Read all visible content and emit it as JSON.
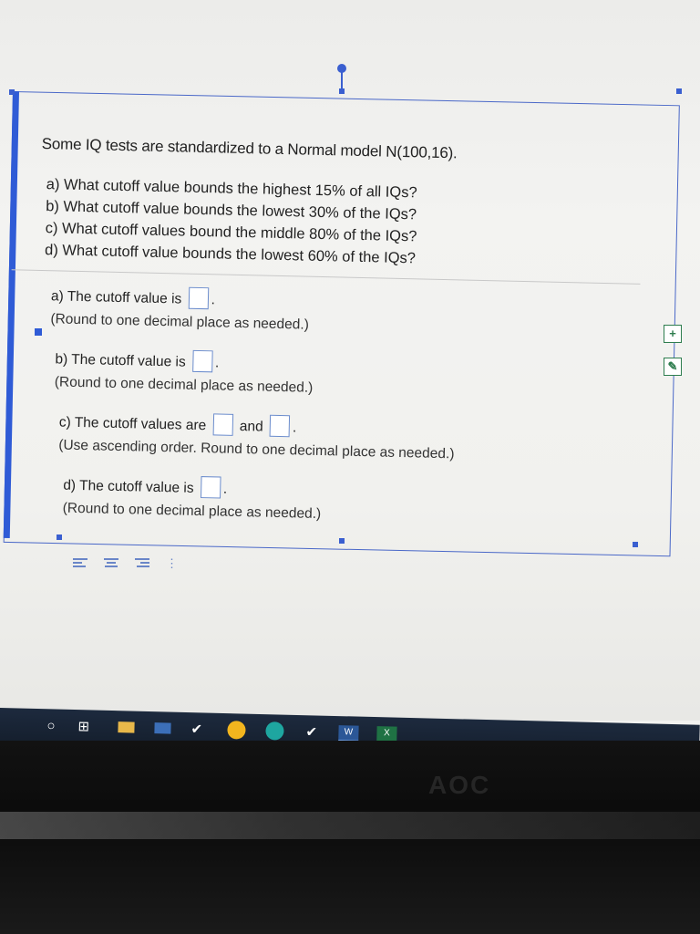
{
  "question": {
    "stem": "Some IQ tests are standardized to a Normal model N(100,16).",
    "parts": [
      "a) What cutoff value bounds the highest 15% of all IQs?",
      "b) What cutoff value bounds the lowest 30% of the IQs?",
      "c) What cutoff values bound the middle 80% of the IQs?",
      "d) What cutoff value bounds the lowest 60% of the IQs?"
    ]
  },
  "answers": {
    "a": {
      "label": "a) The cutoff value is",
      "suffix": ".",
      "value": "",
      "note": "(Round to one decimal place as needed.)"
    },
    "b": {
      "label": "b) The cutoff value is",
      "suffix": ".",
      "value": "",
      "note": "(Round to one decimal place as needed.)"
    },
    "c": {
      "label": "c) The cutoff values are",
      "joiner": "and",
      "suffix": ".",
      "value1": "",
      "value2": "",
      "note": "(Use ascending order. Round to one decimal place as needed.)"
    },
    "d": {
      "label": "d) The cutoff value is",
      "suffix": ".",
      "value": "",
      "note": "(Round to one decimal place as needed.)"
    }
  },
  "side_icons": [
    "add-icon",
    "comment-icon"
  ],
  "taskbar": {
    "icons": [
      "start-icon",
      "task-view-icon",
      "file-explorer-icon",
      "mail-icon",
      "pin-icon",
      "chrome-icon",
      "edge-icon",
      "pin-icon",
      "word-icon",
      "excel-icon"
    ],
    "word_label": "W",
    "excel_label": "X"
  },
  "monitor": {
    "brand": "AOC"
  },
  "colors": {
    "selection": "#3a5fd0",
    "accent_green": "#2e7d4e",
    "taskbar": "#1d2a3e"
  }
}
